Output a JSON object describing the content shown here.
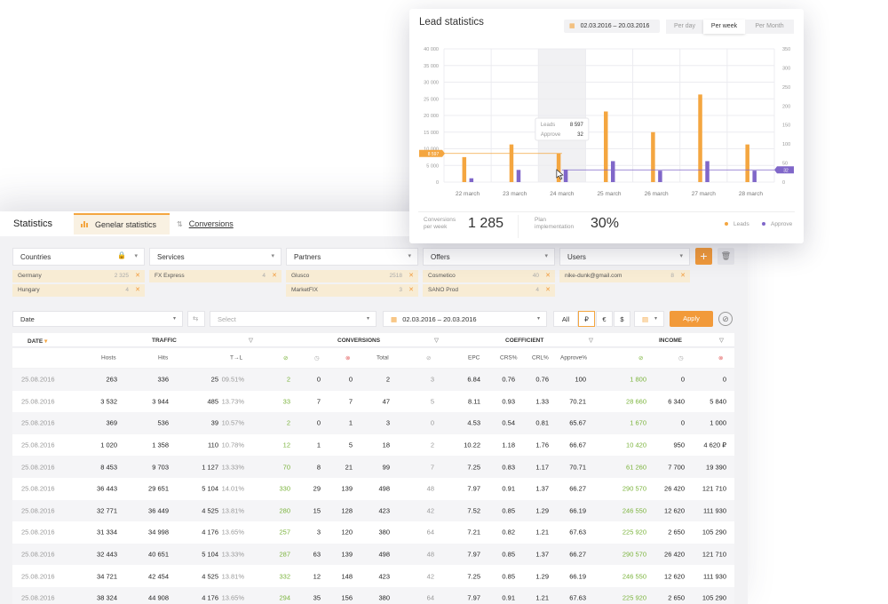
{
  "main": {
    "title": "Statistics",
    "tabs": [
      {
        "label": "Genelar statistics",
        "active": true
      },
      {
        "label": "Conversions",
        "active": false
      }
    ]
  },
  "filters": [
    {
      "label": "Countries",
      "chips": [
        {
          "name": "Germany",
          "count": "2 325"
        },
        {
          "name": "Hungary",
          "count": "4"
        }
      ]
    },
    {
      "label": "Services",
      "chips": [
        {
          "name": "FX Express",
          "count": "4"
        }
      ]
    },
    {
      "label": "Partners",
      "chips": [
        {
          "name": "Glusco",
          "count": "2518"
        },
        {
          "name": "MarketFIX",
          "count": "3"
        }
      ]
    },
    {
      "label": "Offers",
      "chips": [
        {
          "name": "Cosmetico",
          "count": "40"
        },
        {
          "name": "SANO Prod",
          "count": "4"
        }
      ]
    },
    {
      "label": "Users",
      "chips": [
        {
          "name": "nike-dunk@gmail.com",
          "count": "8"
        }
      ]
    }
  ],
  "controls": {
    "group_by": "Date",
    "select_placeholder": "Select",
    "date_range": "02.03.2016 – 20.03.2016",
    "currencies": [
      "All",
      "₽",
      "€",
      "$"
    ],
    "apply_label": "Apply"
  },
  "colors": {
    "accent": "#f4a640",
    "purple": "#8067c9",
    "green": "#7ab33b",
    "red": "#e35d5d"
  },
  "table": {
    "groups": [
      "DATE",
      "TRAFFIC",
      "CONVERSIONS",
      "COEFFICIENT",
      "INCOME"
    ],
    "subheaders": {
      "traffic": [
        "Hosts",
        "Hits",
        "T→L"
      ],
      "conversions_total": "Total",
      "coefficient": [
        "EPC",
        "CRS%",
        "CRL%",
        "Approve%"
      ]
    },
    "rows": [
      [
        "25.08.2016",
        "263",
        "336",
        "25",
        "09.51%",
        "2",
        "0",
        "0",
        "2",
        "3",
        "6.84",
        "0.76",
        "0.76",
        "100",
        "1 800",
        "0",
        "0"
      ],
      [
        "25.08.2016",
        "3 532",
        "3 944",
        "485",
        "13.73%",
        "33",
        "7",
        "7",
        "47",
        "5",
        "8.11",
        "0.93",
        "1.33",
        "70.21",
        "28 660",
        "6 340",
        "5 840"
      ],
      [
        "25.08.2016",
        "369",
        "536",
        "39",
        "10.57%",
        "2",
        "0",
        "1",
        "3",
        "0",
        "4.53",
        "0.54",
        "0.81",
        "65.67",
        "1 670",
        "0",
        "1 000"
      ],
      [
        "25.08.2016",
        "1 020",
        "1 358",
        "110",
        "10.78%",
        "12",
        "1",
        "5",
        "18",
        "2",
        "10.22",
        "1.18",
        "1.76",
        "66.67",
        "10 420",
        "950",
        "4 620 ₽"
      ],
      [
        "25.08.2016",
        "8 453",
        "9 703",
        "1 127",
        "13.33%",
        "70",
        "8",
        "21",
        "99",
        "7",
        "7.25",
        "0.83",
        "1.17",
        "70.71",
        "61 260",
        "7 700",
        "19 390"
      ],
      [
        "25.08.2016",
        "36 443",
        "29 651",
        "5 104",
        "14.01%",
        "330",
        "29",
        "139",
        "498",
        "48",
        "7.97",
        "0.91",
        "1.37",
        "66.27",
        "290 570",
        "26 420",
        "121 710"
      ],
      [
        "25.08.2016",
        "32 771",
        "36 449",
        "4 525",
        "13.81%",
        "280",
        "15",
        "128",
        "423",
        "42",
        "7.52",
        "0.85",
        "1.29",
        "66.19",
        "246 550",
        "12 620",
        "111 930"
      ],
      [
        "25.08.2016",
        "31 334",
        "34 998",
        "4 176",
        "13.65%",
        "257",
        "3",
        "120",
        "380",
        "64",
        "7.21",
        "0.82",
        "1.21",
        "67.63",
        "225 920",
        "2 650",
        "105 290"
      ],
      [
        "25.08.2016",
        "32 443",
        "40 651",
        "5 104",
        "13.33%",
        "287",
        "63",
        "139",
        "498",
        "48",
        "7.97",
        "0.85",
        "1.37",
        "66.27",
        "290 570",
        "26 420",
        "121 710"
      ],
      [
        "25.08.2016",
        "34 721",
        "42 454",
        "4 525",
        "13.81%",
        "332",
        "12",
        "148",
        "423",
        "42",
        "7.25",
        "0.85",
        "1.29",
        "66.19",
        "246 550",
        "12 620",
        "111 930"
      ],
      [
        "25.08.2016",
        "38 324",
        "44 908",
        "4 176",
        "13.65%",
        "294",
        "35",
        "156",
        "380",
        "64",
        "7.97",
        "0.91",
        "1.21",
        "67.63",
        "225 920",
        "2 650",
        "105 290"
      ]
    ]
  },
  "lead": {
    "title": "Lead statistics",
    "date_range": "02.03.2016 – 20.03.2016",
    "periods": [
      "Per day",
      "Per week",
      "Per Month"
    ],
    "active_period": "Per week",
    "tooltip": {
      "leads_label": "Leads",
      "leads_value": "8 597",
      "approve_label": "Approve",
      "approve_value": "32"
    },
    "left_marker": "8 597",
    "right_marker": "32",
    "conversions_label": "Conversions per week",
    "conversions_value": "1 285",
    "plan_label": "Plan implementation",
    "plan_value": "30%",
    "legend": [
      "Leads",
      "Approve"
    ]
  },
  "chart_data": {
    "type": "bar",
    "categories": [
      "22 march",
      "23 march",
      "24 march",
      "25 march",
      "26 march",
      "27 march",
      "28 march"
    ],
    "series": [
      {
        "name": "Leads",
        "axis": "left",
        "color": "#f4a640",
        "values": [
          7500,
          11300,
          8597,
          21200,
          15000,
          26300,
          11300
        ]
      },
      {
        "name": "Approve",
        "axis": "right",
        "color": "#8067c9",
        "values": [
          10,
          32,
          32,
          55,
          30,
          55,
          30
        ]
      }
    ],
    "ylim_left": [
      0,
      40000
    ],
    "yticks_left": [
      "0",
      "5 000",
      "10 000",
      "15 000",
      "20 000",
      "25 000",
      "30 000",
      "35 000",
      "40 000"
    ],
    "ylim_right": [
      0,
      350
    ],
    "yticks_right": [
      "0",
      "50",
      "100",
      "150",
      "200",
      "250",
      "300",
      "350"
    ],
    "grid": true
  }
}
